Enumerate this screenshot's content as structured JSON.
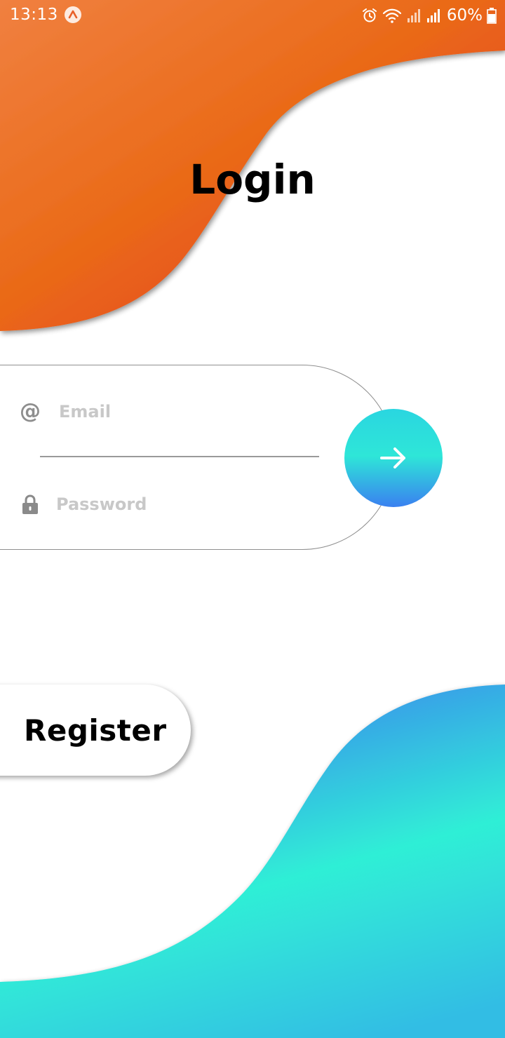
{
  "status_bar": {
    "time": "13:13",
    "app_icon": "arrow-up-circle-icon",
    "alarm_icon": "alarm-clock-icon",
    "wifi_icon": "wifi-icon",
    "signal_icon": "cell-signal-icon",
    "battery_percent": "60%",
    "battery_icon": "battery-icon"
  },
  "title": "Login",
  "form": {
    "email": {
      "icon": "at-sign-icon",
      "icon_glyph": "@",
      "placeholder": "Email",
      "value": ""
    },
    "password": {
      "icon": "lock-icon",
      "placeholder": "Password",
      "value": ""
    },
    "submit_icon": "arrow-right-icon"
  },
  "register": {
    "label": "Register"
  },
  "colors": {
    "top_blob_start": "#f07a35",
    "top_blob_mid": "#ea6a1a",
    "top_blob_end": "#e5352a",
    "bottom_blob_start": "#3c80ee",
    "bottom_blob_mid": "#2eebd8",
    "bottom_blob_end": "#2fc0e0",
    "go_button_top": "#2ad6e0",
    "go_button_bottom": "#3a80f0"
  }
}
